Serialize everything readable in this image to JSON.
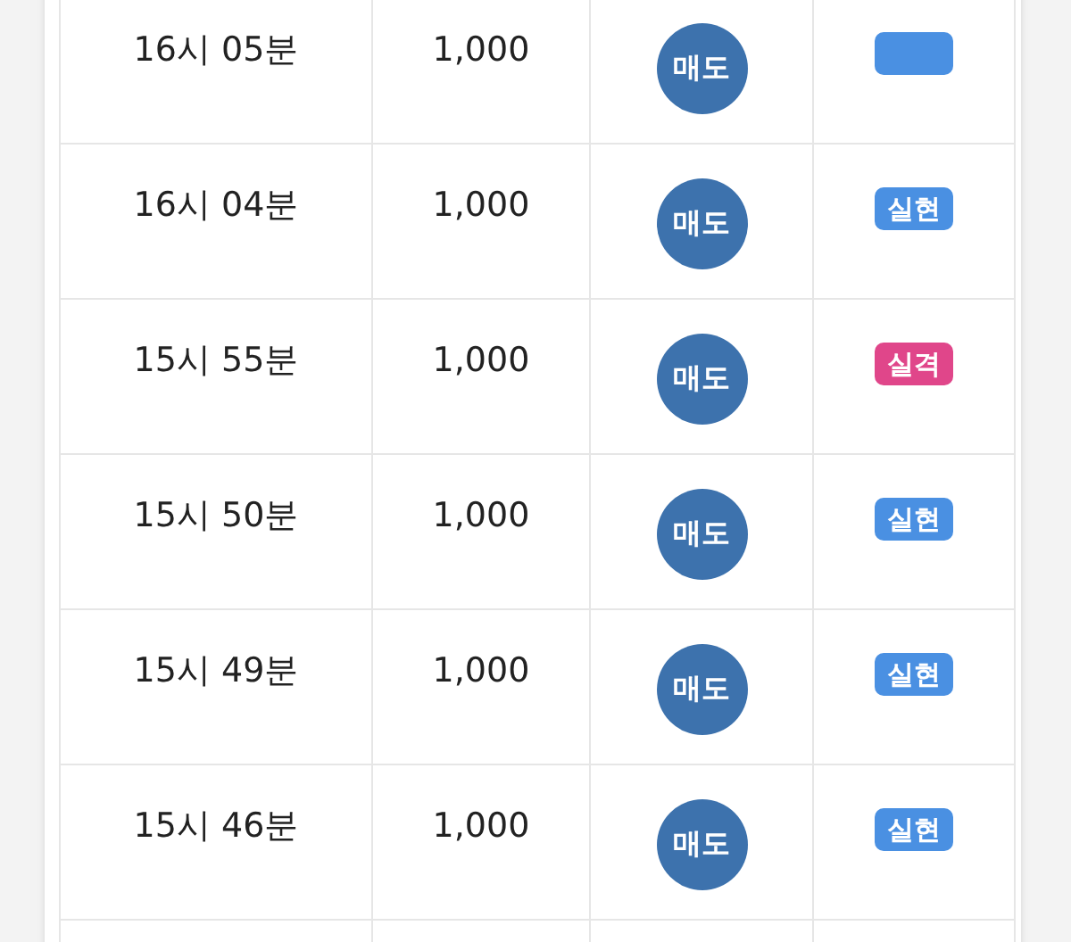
{
  "rows": [
    {
      "time": "16시 05분",
      "amount": "1,000",
      "action": "매도",
      "result": {
        "kind": "profit"
      }
    },
    {
      "time": "16시 04분",
      "amount": "1,000",
      "action": "매도",
      "result": {
        "kind": "profit",
        "label": "실현"
      }
    },
    {
      "time": "15시 55분",
      "amount": "1,000",
      "action": "매도",
      "result": {
        "kind": "loss",
        "label": "실격"
      }
    },
    {
      "time": "15시 50분",
      "amount": "1,000",
      "action": "매도",
      "result": {
        "kind": "profit",
        "label": "실현"
      }
    },
    {
      "time": "15시 49분",
      "amount": "1,000",
      "action": "매도",
      "result": {
        "kind": "profit",
        "label": "실현"
      }
    },
    {
      "time": "15시 46분",
      "amount": "1,000",
      "action": "매도",
      "result": {
        "kind": "profit",
        "label": "실현"
      }
    }
  ]
}
